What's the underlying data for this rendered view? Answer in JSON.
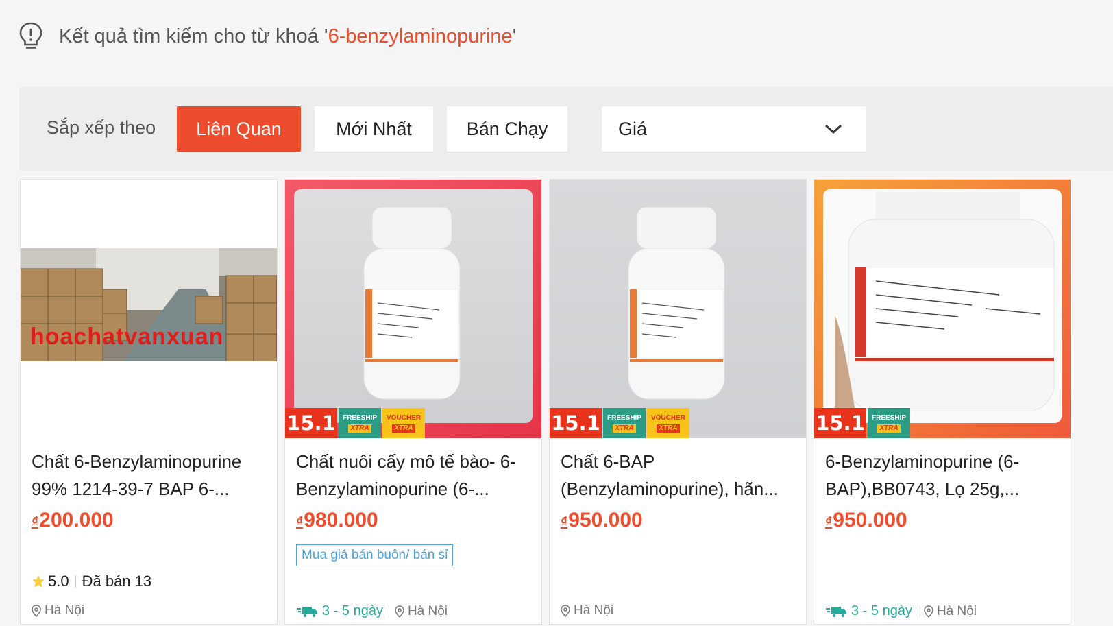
{
  "search": {
    "prefix": "Kết quả tìm kiếm cho từ khoá '",
    "keyword": "6-benzylaminopurine",
    "suffix": "'"
  },
  "sort": {
    "label": "Sắp xếp theo",
    "options": [
      "Liên Quan",
      "Mới Nhất",
      "Bán Chạy"
    ],
    "active": "Liên Quan",
    "price_label": "Giá"
  },
  "products": [
    {
      "title": "Chất 6-Benzylaminopurine 99% 1214-39-7 BAP 6-...",
      "currency": "₫",
      "price": "200.000",
      "image_caption": "hoachatvanxuan",
      "rating": "5.0",
      "sold": "Đã bán 13",
      "location": "Hà Nội"
    },
    {
      "title": "Chất nuôi cấy mô tế bào- 6-Benzylaminopurine (6-...",
      "currency": "₫",
      "price": "980.000",
      "promo": "Mua giá bán buôn/ bán sỉ",
      "shipping": "3 - 5 ngày",
      "location": "Hà Nội",
      "badges": {
        "sale": "15.1",
        "free_top": "FREESHIP",
        "free_bottom": "XTRA",
        "voucher_top": "VOUCHER",
        "voucher_bottom": "XTRA"
      }
    },
    {
      "title": "Chất 6-BAP (Benzylaminopurine), hãn...",
      "currency": "₫",
      "price": "950.000",
      "location": "Hà Nội",
      "badges": {
        "sale": "15.1",
        "free_top": "FREESHIP",
        "free_bottom": "XTRA",
        "voucher_top": "VOUCHER",
        "voucher_bottom": "XTRA"
      }
    },
    {
      "title": "6-Benzylaminopurine (6-BAP),BB0743, Lọ 25g,...",
      "currency": "₫",
      "price": "950.000",
      "shipping": "3 - 5 ngày",
      "location": "Hà Nội",
      "badges": {
        "sale": "15.1",
        "free_top": "FREESHIP",
        "free_bottom": "XTRA"
      }
    }
  ],
  "colors": {
    "accent": "#ee4d2d",
    "shipping": "#26aa99",
    "star": "#ffce3d"
  }
}
